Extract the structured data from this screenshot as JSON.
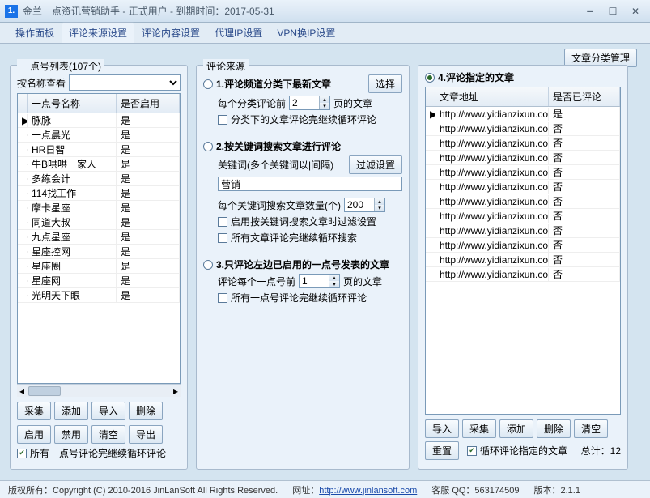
{
  "title": "金兰一点资讯营销助手 - 正式用户 - 到期时间：2017-05-31",
  "win_icon": "1.",
  "tabs": [
    "操作面板",
    "评论来源设置",
    "评论内容设置",
    "代理IP设置",
    "VPN换IP设置"
  ],
  "top_right_btn": "文章分类管理",
  "left": {
    "title": "一点号列表(107个)",
    "name_lookup_label": "按名称查看",
    "cols": [
      "一点号名称",
      "是否启用"
    ],
    "rows": [
      {
        "marker": "▶",
        "name": "脉脉",
        "enabled": "是"
      },
      {
        "marker": "",
        "name": "一点晨光",
        "enabled": "是"
      },
      {
        "marker": "",
        "name": "HR日智",
        "enabled": "是"
      },
      {
        "marker": "",
        "name": "牛B哄哄一家人",
        "enabled": "是"
      },
      {
        "marker": "",
        "name": "多练会计",
        "enabled": "是"
      },
      {
        "marker": "",
        "name": "114找工作",
        "enabled": "是"
      },
      {
        "marker": "",
        "name": "摩卡星座",
        "enabled": "是"
      },
      {
        "marker": "",
        "name": "同道大叔",
        "enabled": "是"
      },
      {
        "marker": "",
        "name": "九点星座",
        "enabled": "是"
      },
      {
        "marker": "",
        "name": "星座控网",
        "enabled": "是"
      },
      {
        "marker": "",
        "name": "星座圈",
        "enabled": "是"
      },
      {
        "marker": "",
        "name": "星座网",
        "enabled": "是"
      },
      {
        "marker": "",
        "name": "光明天下眼",
        "enabled": "是"
      }
    ],
    "btns1": [
      "采集",
      "添加",
      "导入",
      "删除"
    ],
    "btns2": [
      "启用",
      "禁用",
      "清空",
      "导出"
    ],
    "cb_label": "所有一点号评论完继续循环评论"
  },
  "mid": {
    "title": "评论来源",
    "s1": {
      "radio": "1.评论频道分类下最新文章",
      "select_btn": "选择",
      "per_category_prefix": "每个分类评论前",
      "per_category_value": "2",
      "per_category_suffix": "页的文章",
      "cb": "分类下的文章评论完继续循环评论"
    },
    "s2": {
      "radio": "2.按关键词搜索文章进行评论",
      "kw_label": "关键词(多个关键词以|间隔)",
      "filter_btn": "过滤设置",
      "kw_value": "营销",
      "count_label": "每个关键词搜索文章数量(个)",
      "count_value": "200",
      "cb1": "启用按关键词搜索文章时过滤设置",
      "cb2": "所有文章评论完继续循环搜索"
    },
    "s3": {
      "radio": "3.只评论左边已启用的一点号发表的文章",
      "prefix": "评论每个一点号前",
      "value": "1",
      "suffix": "页的文章",
      "cb": "所有一点号评论完继续循环评论"
    }
  },
  "right": {
    "radio": "4.评论指定的文章",
    "cols": [
      "文章地址",
      "是否已评论"
    ],
    "rows": [
      {
        "marker": "▶",
        "url": "http://www.yidianzixun.com/",
        "done": "是"
      },
      {
        "marker": "",
        "url": "http://www.yidianzixun.com/",
        "done": "否"
      },
      {
        "marker": "",
        "url": "http://www.yidianzixun.com/",
        "done": "否"
      },
      {
        "marker": "",
        "url": "http://www.yidianzixun.com/",
        "done": "否"
      },
      {
        "marker": "",
        "url": "http://www.yidianzixun.com/",
        "done": "否"
      },
      {
        "marker": "",
        "url": "http://www.yidianzixun.com/",
        "done": "否"
      },
      {
        "marker": "",
        "url": "http://www.yidianzixun.com/",
        "done": "否"
      },
      {
        "marker": "",
        "url": "http://www.yidianzixun.com/",
        "done": "否"
      },
      {
        "marker": "",
        "url": "http://www.yidianzixun.com/",
        "done": "否"
      },
      {
        "marker": "",
        "url": "http://www.yidianzixun.com/",
        "done": "否"
      },
      {
        "marker": "",
        "url": "http://www.yidianzixun.com/",
        "done": "否"
      },
      {
        "marker": "",
        "url": "http://www.yidianzixun.com/",
        "done": "否"
      }
    ],
    "btns": [
      "导入",
      "采集",
      "添加",
      "删除",
      "清空"
    ],
    "reset_btn": "重置",
    "cb": "循环评论指定的文章",
    "total_label": "总计：12"
  },
  "status": {
    "copyright_label": "版权所有：",
    "copyright": "Copyright (C) 2010-2016 JinLanSoft All Rights Reserved.",
    "site_label": "网址：",
    "site": "http://www.jinlansoft.com",
    "qq_label": "客服 QQ：563174509",
    "version_label": "版本：2.1.1"
  }
}
